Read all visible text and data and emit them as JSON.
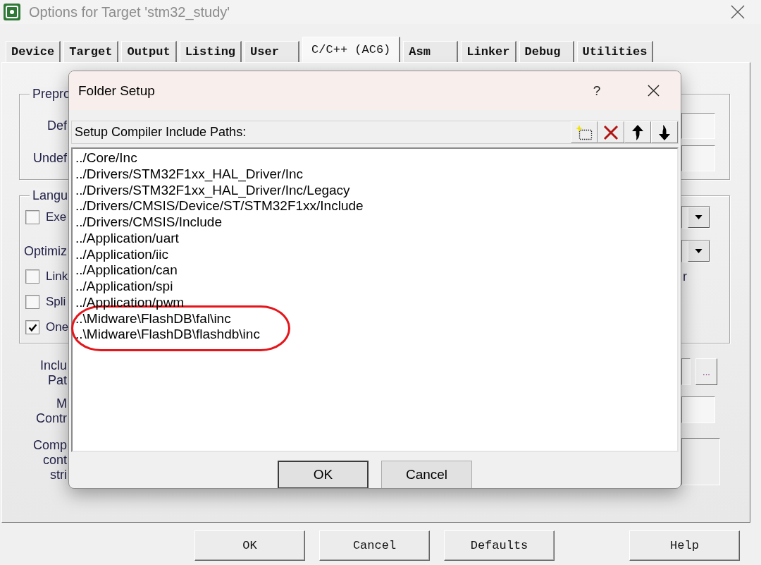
{
  "window": {
    "title": "Options for Target 'stm32_study'"
  },
  "tabs": [
    {
      "label": "Device",
      "selected": false
    },
    {
      "label": "Target",
      "selected": false
    },
    {
      "label": "Output",
      "selected": false
    },
    {
      "label": "Listing",
      "selected": false
    },
    {
      "label": "User",
      "selected": false
    },
    {
      "label": "C/C++ (AC6)",
      "selected": true
    },
    {
      "label": "Asm",
      "selected": false
    },
    {
      "label": "Linker",
      "selected": false
    },
    {
      "label": "Debug",
      "selected": false
    },
    {
      "label": "Utilities",
      "selected": false
    }
  ],
  "page": {
    "groups": [
      {
        "legend": "Prepro",
        "rows": [
          {
            "kind": "label",
            "label": "Def",
            "control": {
              "kind": "field"
            }
          },
          {
            "kind": "label",
            "label": "Undef",
            "control": {
              "kind": "field"
            }
          }
        ]
      },
      {
        "legend": "Langu",
        "rows": [
          {
            "kind": "checkbox",
            "label": "Exe",
            "checked": false,
            "control": {
              "kind": "dropdown"
            }
          },
          {
            "kind": "label",
            "label": "Optimiz",
            "control": {
              "kind": "dropdown"
            }
          },
          {
            "kind": "checkbox",
            "label": "Link",
            "checked": false,
            "note": "r"
          },
          {
            "kind": "checkbox",
            "label": "Spli",
            "checked": false
          },
          {
            "kind": "checkbox",
            "label": "One",
            "checked": true
          }
        ]
      }
    ],
    "rows": [
      {
        "lines": [
          "Inclu",
          "Pat"
        ],
        "control": {
          "kind": "browse",
          "button": "..."
        }
      },
      {
        "lines": [
          "M",
          "Contr"
        ],
        "control": {
          "kind": "field"
        }
      },
      {
        "lines": [
          "Comp",
          "cont",
          "stri"
        ],
        "control": {
          "kind": "textarea"
        }
      }
    ]
  },
  "buttons": [
    "OK",
    "Cancel",
    "Defaults",
    "Help"
  ],
  "dialog": {
    "title": "Folder Setup",
    "help": "?",
    "header": "Setup Compiler Include Paths:",
    "paths": [
      {
        "text": "../Core/Inc",
        "selected": false,
        "circled": false
      },
      {
        "text": "../Drivers/STM32F1xx_HAL_Driver/Inc",
        "selected": false,
        "circled": false
      },
      {
        "text": "../Drivers/STM32F1xx_HAL_Driver/Inc/Legacy",
        "selected": false,
        "circled": false
      },
      {
        "text": "../Drivers/CMSIS/Device/ST/STM32F1xx/Include",
        "selected": false,
        "circled": false
      },
      {
        "text": "../Drivers/CMSIS/Include",
        "selected": false,
        "circled": false
      },
      {
        "text": "../Application/uart",
        "selected": false,
        "circled": false
      },
      {
        "text": "../Application/iic",
        "selected": false,
        "circled": false
      },
      {
        "text": "../Application/can",
        "selected": false,
        "circled": false
      },
      {
        "text": "../Application/spi",
        "selected": false,
        "circled": false
      },
      {
        "text": "../Application/pwm",
        "selected": false,
        "circled": false
      },
      {
        "text": "..\\Midware\\FlashDB\\fal\\inc",
        "selected": false,
        "circled": true
      },
      {
        "text": "..\\Midware\\FlashDB\\flashdb\\inc",
        "selected": false,
        "circled": true
      }
    ],
    "buttons": [
      {
        "label": "OK",
        "default": true
      },
      {
        "label": "Cancel",
        "default": false
      }
    ]
  }
}
